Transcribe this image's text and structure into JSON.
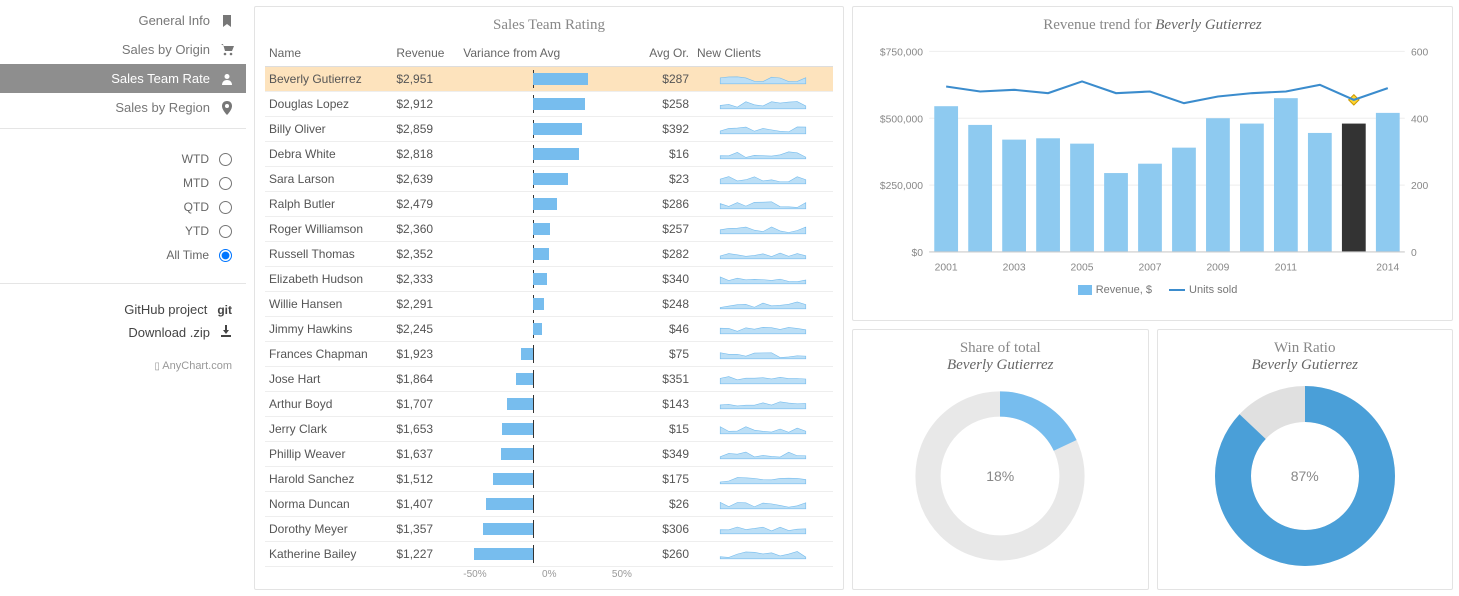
{
  "sidebar": {
    "nav": [
      {
        "label": "General Info",
        "icon": "bookmark"
      },
      {
        "label": "Sales by Origin",
        "icon": "cart"
      },
      {
        "label": "Sales Team Rate",
        "icon": "user",
        "active": true
      },
      {
        "label": "Sales by Region",
        "icon": "pin"
      }
    ],
    "radios": [
      {
        "label": "WTD",
        "checked": false
      },
      {
        "label": "MTD",
        "checked": false
      },
      {
        "label": "QTD",
        "checked": false
      },
      {
        "label": "YTD",
        "checked": false
      },
      {
        "label": "All Time",
        "checked": true
      }
    ],
    "links": [
      {
        "label": "GitHub project",
        "icon": "git"
      },
      {
        "label": "Download .zip",
        "icon": "download"
      }
    ],
    "footer": "AnyChart.com"
  },
  "table": {
    "title": "Sales Team Rating",
    "headers": {
      "name": "Name",
      "revenue": "Revenue",
      "variance": "Variance from Avg",
      "avgor": "Avg Or.",
      "newclients": "New Clients"
    },
    "axis": {
      "left": "-50%",
      "mid": "0%",
      "right": "50%"
    },
    "rows": [
      {
        "name": "Beverly Gutierrez",
        "rev": "$2,951",
        "var": 39,
        "avg": "$287",
        "sel": true
      },
      {
        "name": "Douglas Lopez",
        "rev": "$2,912",
        "var": 37,
        "avg": "$258"
      },
      {
        "name": "Billy Oliver",
        "rev": "$2,859",
        "var": 35,
        "avg": "$392"
      },
      {
        "name": "Debra White",
        "rev": "$2,818",
        "var": 33,
        "avg": "$16"
      },
      {
        "name": "Sara Larson",
        "rev": "$2,639",
        "var": 25,
        "avg": "$23"
      },
      {
        "name": "Ralph Butler",
        "rev": "$2,479",
        "var": 17,
        "avg": "$286"
      },
      {
        "name": "Roger Williamson",
        "rev": "$2,360",
        "var": 12,
        "avg": "$257"
      },
      {
        "name": "Russell Thomas",
        "rev": "$2,352",
        "var": 11,
        "avg": "$282"
      },
      {
        "name": "Elizabeth Hudson",
        "rev": "$2,333",
        "var": 10,
        "avg": "$340"
      },
      {
        "name": "Willie Hansen",
        "rev": "$2,291",
        "var": 8,
        "avg": "$248"
      },
      {
        "name": "Jimmy Hawkins",
        "rev": "$2,245",
        "var": 6,
        "avg": "$46"
      },
      {
        "name": "Frances Chapman",
        "rev": "$1,923",
        "var": -9,
        "avg": "$75"
      },
      {
        "name": "Jose Hart",
        "rev": "$1,864",
        "var": -12,
        "avg": "$351"
      },
      {
        "name": "Arthur Boyd",
        "rev": "$1,707",
        "var": -19,
        "avg": "$143"
      },
      {
        "name": "Jerry Clark",
        "rev": "$1,653",
        "var": -22,
        "avg": "$15"
      },
      {
        "name": "Phillip Weaver",
        "rev": "$1,637",
        "var": -23,
        "avg": "$349"
      },
      {
        "name": "Harold Sanchez",
        "rev": "$1,512",
        "var": -29,
        "avg": "$175"
      },
      {
        "name": "Norma Duncan",
        "rev": "$1,407",
        "var": -34,
        "avg": "$26"
      },
      {
        "name": "Dorothy Meyer",
        "rev": "$1,357",
        "var": -36,
        "avg": "$306"
      },
      {
        "name": "Katherine Bailey",
        "rev": "$1,227",
        "var": -42,
        "avg": "$260"
      }
    ]
  },
  "trend": {
    "title_prefix": "Revenue trend for ",
    "title_name": "Beverly Gutierrez",
    "y_left": {
      "ticks": [
        "$750,000",
        "$500,000",
        "$250,000",
        "$0"
      ]
    },
    "y_right": {
      "ticks": [
        "600",
        "400",
        "200",
        "0"
      ]
    },
    "x_ticks": [
      "2001",
      "2003",
      "2005",
      "2007",
      "2009",
      "2011",
      "2014"
    ],
    "legend": {
      "revenue": "Revenue, $",
      "units": "Units sold"
    }
  },
  "share": {
    "title": "Share of total",
    "name": "Beverly Gutierrez",
    "value": "18%",
    "pct": 18
  },
  "win": {
    "title": "Win Ratio",
    "name": "Beverly Gutierrez",
    "value": "87%",
    "pct": 87
  },
  "chart_data": {
    "trend": {
      "type": "bar+line",
      "title": "Revenue trend for Beverly Gutierrez",
      "x": [
        2001,
        2002,
        2003,
        2004,
        2005,
        2006,
        2007,
        2008,
        2009,
        2010,
        2011,
        2012,
        2013,
        2014
      ],
      "series": [
        {
          "name": "Revenue, $",
          "type": "bar",
          "values": [
            545000,
            475000,
            420000,
            425000,
            405000,
            295000,
            330000,
            390000,
            500000,
            480000,
            575000,
            445000,
            480000,
            520000
          ],
          "ylim": [
            0,
            750000
          ]
        },
        {
          "name": "Units sold",
          "type": "line",
          "values": [
            495,
            480,
            485,
            475,
            510,
            475,
            480,
            445,
            465,
            475,
            480,
            500,
            455,
            490
          ],
          "ylim": [
            0,
            600
          ]
        }
      ],
      "highlight_index": 12
    },
    "share": {
      "type": "donut",
      "value": 18,
      "max": 100,
      "title": "Share of total — Beverly Gutierrez"
    },
    "win": {
      "type": "donut",
      "value": 87,
      "max": 100,
      "title": "Win Ratio — Beverly Gutierrez"
    }
  }
}
